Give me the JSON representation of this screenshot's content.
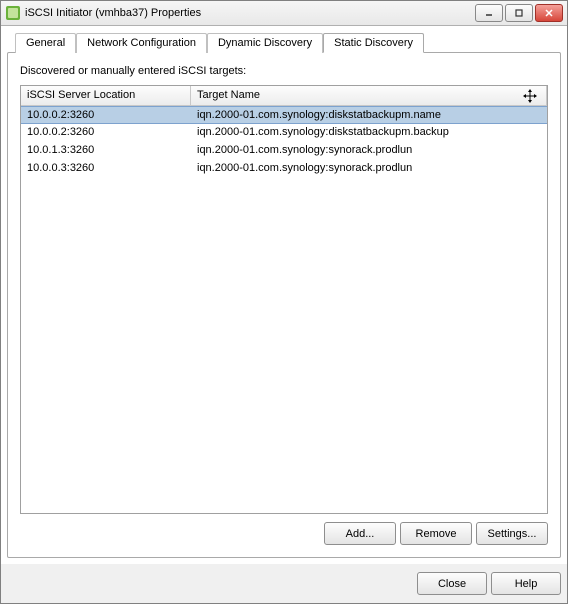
{
  "window": {
    "title": "iSCSI Initiator (vmhba37) Properties"
  },
  "tabs": {
    "general": "General",
    "network": "Network Configuration",
    "dynamic": "Dynamic Discovery",
    "static": "Static Discovery"
  },
  "panel": {
    "label": "Discovered or manually entered iSCSI targets:"
  },
  "columns": {
    "server": "iSCSI Server Location",
    "target": "Target Name"
  },
  "rows": [
    {
      "server": "10.0.0.2:3260",
      "target": "iqn.2000-01.com.synology:diskstatbackupm.name",
      "selected": true
    },
    {
      "server": "10.0.0.2:3260",
      "target": "iqn.2000-01.com.synology:diskstatbackupm.backup",
      "selected": false
    },
    {
      "server": "10.0.1.3:3260",
      "target": "iqn.2000-01.com.synology:synorack.prodlun",
      "selected": false
    },
    {
      "server": "10.0.0.3:3260",
      "target": "iqn.2000-01.com.synology:synorack.prodlun",
      "selected": false
    }
  ],
  "buttons": {
    "add": "Add...",
    "remove": "Remove",
    "settings": "Settings...",
    "close": "Close",
    "help": "Help"
  }
}
